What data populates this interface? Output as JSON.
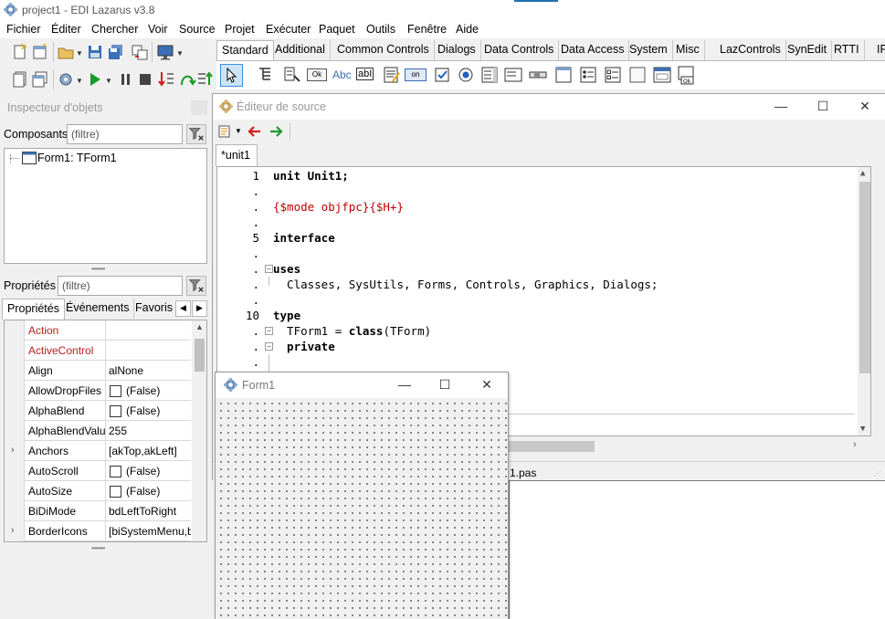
{
  "window": {
    "title": "project1 - EDI Lazarus v3.8"
  },
  "menu": [
    "Fichier",
    "Éditer",
    "Chercher",
    "Voir",
    "Source",
    "Projet",
    "Exécuter",
    "Paquet",
    "Outils",
    "Fenêtre",
    "Aide"
  ],
  "palette": {
    "tabs": [
      "Standard",
      "Additional",
      "Common Controls",
      "Dialogs",
      "Data Controls",
      "Data Access",
      "System",
      "Misc",
      "LazControls",
      "SynEdit",
      "RTTI",
      "IP"
    ],
    "active_tab": "Standard",
    "button_labels": {
      "ok": "Ok",
      "abc": "Abc",
      "abi": "abI",
      "on": "on"
    }
  },
  "inspector": {
    "title": "Inspecteur d'objets",
    "components_label": "Composants",
    "components_filter_placeholder": "(filtre)",
    "tree_item": "Form1: TForm1",
    "properties_label": "Propriétés",
    "properties_filter_placeholder": "(filtre)",
    "tabs": [
      "Propriétés",
      "Événements",
      "Favoris"
    ],
    "properties": [
      {
        "name": "Action",
        "value": "",
        "highlight": true
      },
      {
        "name": "ActiveControl",
        "value": "",
        "highlight": true
      },
      {
        "name": "Align",
        "value": "alNone"
      },
      {
        "name": "AllowDropFiles",
        "value": "(False)",
        "checkbox": true
      },
      {
        "name": "AlphaBlend",
        "value": "(False)",
        "checkbox": true
      },
      {
        "name": "AlphaBlendValue",
        "value": "255"
      },
      {
        "name": "Anchors",
        "value": "[akTop,akLeft]",
        "expandable": true
      },
      {
        "name": "AutoScroll",
        "value": "(False)",
        "checkbox": true
      },
      {
        "name": "AutoSize",
        "value": "(False)",
        "checkbox": true
      },
      {
        "name": "BiDiMode",
        "value": "bdLeftToRight"
      },
      {
        "name": "BorderIcons",
        "value": "[biSystemMenu,biMinimize]",
        "expandable": true
      }
    ]
  },
  "editor": {
    "title": "Éditeur de source",
    "tab": "*unit1",
    "status_file": "1.pas",
    "line_numbers": [
      "1",
      "",
      "",
      "",
      "5",
      "",
      "",
      "",
      "",
      "10",
      "",
      "",
      ""
    ],
    "code": {
      "l1": "unit Unit1;",
      "l3": "{$mode objfpc}{$H+}",
      "l5": "interface",
      "l7": "uses",
      "l8": "  Classes, SysUtils, Forms, Controls, Graphics, Dialogs;",
      "l10": "type",
      "l11a": "  TForm1 = ",
      "l11b": "class",
      "l11c": "(TForm)",
      "l12": "  private"
    }
  },
  "form": {
    "title": "Form1"
  },
  "colors": {
    "accent": "#1f6fb2",
    "directive": "#c00000",
    "property_highlight": "#b22222"
  }
}
